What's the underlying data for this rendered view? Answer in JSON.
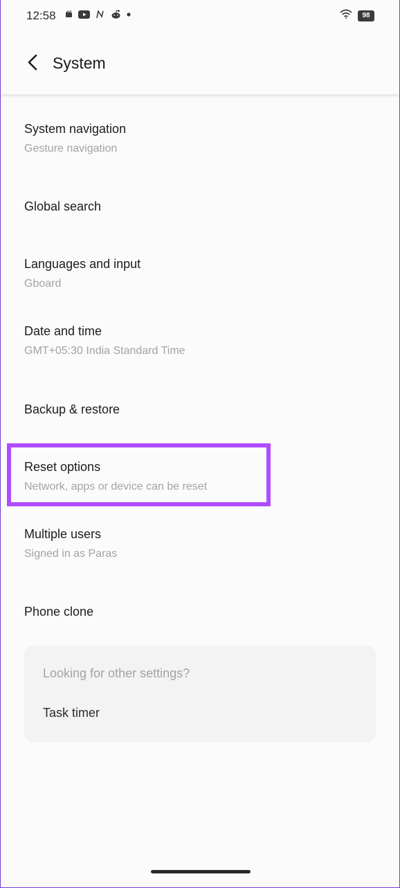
{
  "status_bar": {
    "time": "12:58",
    "battery": "98"
  },
  "header": {
    "title": "System"
  },
  "settings_items": [
    {
      "title": "System navigation",
      "subtitle": "Gesture navigation"
    },
    {
      "title": "Global search"
    },
    {
      "title": "Languages and input",
      "subtitle": "Gboard"
    },
    {
      "title": "Date and time",
      "subtitle": "GMT+05:30 India Standard Time"
    },
    {
      "title": "Backup & restore"
    },
    {
      "title": "Reset options",
      "subtitle": "Network, apps or device can be reset"
    },
    {
      "title": "Multiple users",
      "subtitle": "Signed in as Paras"
    },
    {
      "title": "Phone clone"
    }
  ],
  "suggestions": {
    "heading": "Looking for other settings?",
    "link": "Task timer"
  },
  "colors": {
    "highlight": "#b04dff",
    "background": "#fbfbfb",
    "primary_text": "#1c1c1c",
    "secondary_text": "#a3a3a3"
  }
}
